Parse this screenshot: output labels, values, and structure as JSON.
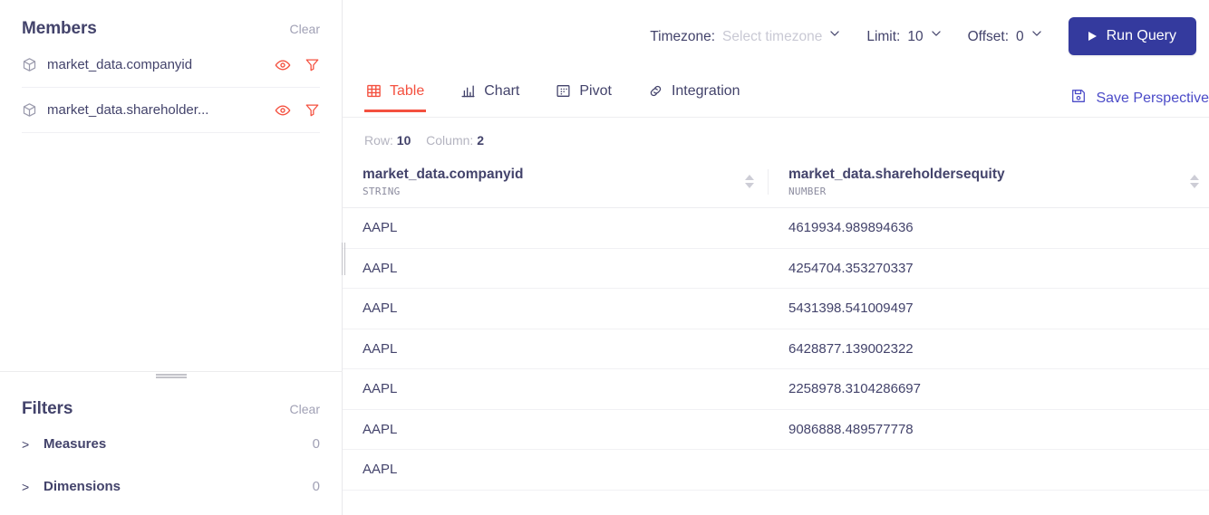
{
  "sidebar": {
    "members": {
      "title": "Members",
      "clear_label": "Clear",
      "items": [
        {
          "icon": "cube-icon",
          "label": "market_data.companyid",
          "actions": [
            "eye-icon",
            "filter-funnel-icon"
          ]
        },
        {
          "icon": "cube-icon",
          "label": "market_data.shareholder...",
          "actions": [
            "eye-icon",
            "filter-funnel-icon"
          ]
        }
      ]
    },
    "filters": {
      "title": "Filters",
      "clear_label": "Clear",
      "groups": [
        {
          "chevron": ">",
          "name": "Measures",
          "count": "0"
        },
        {
          "chevron": ">",
          "name": "Dimensions",
          "count": "0"
        }
      ]
    }
  },
  "toolbar": {
    "timezone": {
      "label": "Timezone:",
      "value": "Select timezone",
      "is_placeholder": true,
      "caret": "chevron-down-icon"
    },
    "limit": {
      "label": "Limit:",
      "value": "10",
      "caret": "chevron-down-icon"
    },
    "offset": {
      "label": "Offset:",
      "value": "0",
      "caret": "chevron-down-icon"
    },
    "run_button": {
      "label": "Run Query",
      "icon": "play-icon",
      "color": "#343a9e"
    }
  },
  "tabs": {
    "items": [
      {
        "label": "Table",
        "icon": "table-grid-icon",
        "active": true
      },
      {
        "label": "Chart",
        "icon": "bar-chart-icon",
        "active": false
      },
      {
        "label": "Pivot",
        "icon": "pivot-dots-icon",
        "active": false
      },
      {
        "label": "Integration",
        "icon": "link-chain-icon",
        "active": false
      }
    ],
    "active_color": "#f4503f",
    "save_perspective": {
      "label": "Save Perspective",
      "icon": "save-disk-icon",
      "color": "#4b4bc8"
    }
  },
  "results": {
    "row_label": "Row:",
    "row_count": "10",
    "column_label": "Column:",
    "column_count": "2",
    "columns": [
      {
        "name": "market_data.companyid",
        "type": "STRING"
      },
      {
        "name": "market_data.shareholdersequity",
        "type": "NUMBER"
      }
    ],
    "rows": [
      {
        "companyid": "AAPL",
        "shareholdersequity": "4619934.989894636"
      },
      {
        "companyid": "AAPL",
        "shareholdersequity": "4254704.353270337"
      },
      {
        "companyid": "AAPL",
        "shareholdersequity": "5431398.541009497"
      },
      {
        "companyid": "AAPL",
        "shareholdersequity": "6428877.139002322"
      },
      {
        "companyid": "AAPL",
        "shareholdersequity": "2258978.3104286697"
      },
      {
        "companyid": "AAPL",
        "shareholdersequity": "9086888.489577778"
      },
      {
        "companyid": "AAPL",
        "shareholdersequity": ""
      }
    ]
  }
}
